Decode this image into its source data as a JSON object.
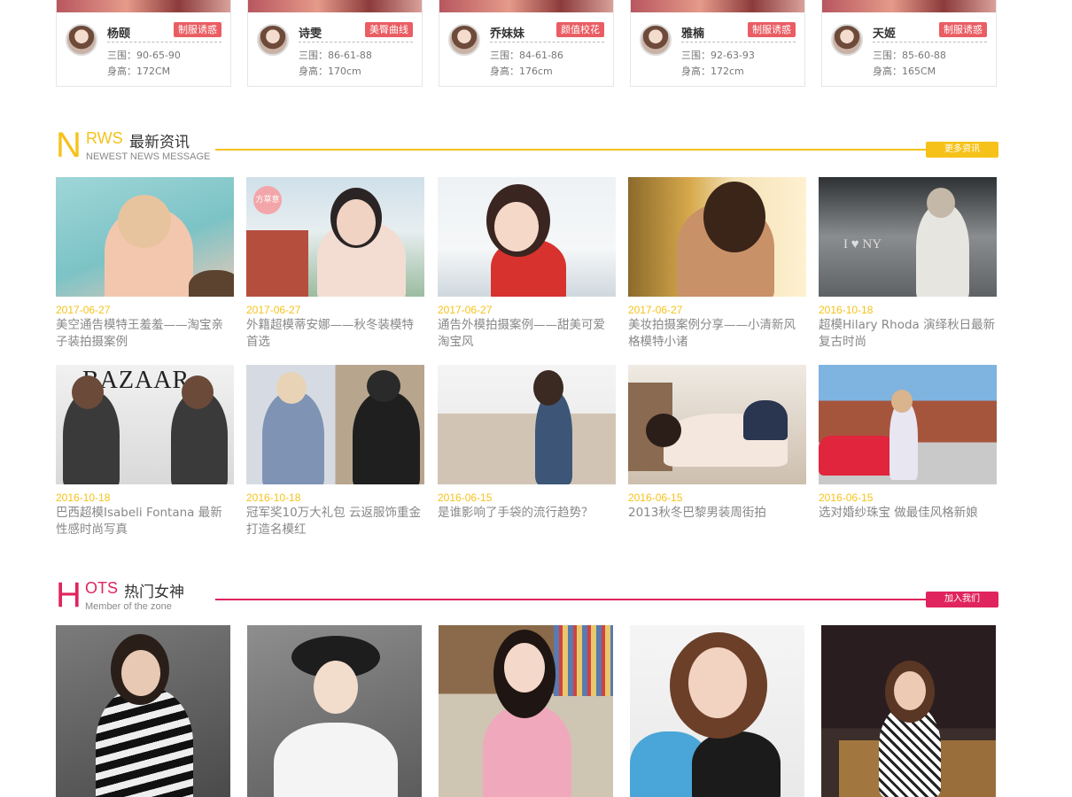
{
  "models": [
    {
      "name": "杨颐",
      "badge": "制服诱惑",
      "measure": "三围：90-65-90",
      "height": "身高：172CM"
    },
    {
      "name": "诗雯",
      "badge": "美臀曲线",
      "measure": "三围：86-61-88",
      "height": "身高：170cm"
    },
    {
      "name": "乔妹妹",
      "badge": "颜值校花",
      "measure": "三围：84-61-86",
      "height": "身高：176cm"
    },
    {
      "name": "雅楠",
      "badge": "制服诱惑",
      "measure": "三围：92-63-93",
      "height": "身高：172cm"
    },
    {
      "name": "天姬",
      "badge": "制服诱惑",
      "measure": "三围：85-60-88",
      "height": "身高：165CM"
    }
  ],
  "news_section": {
    "big_letter": "N",
    "small_letters": "RWS",
    "title": "最新资讯",
    "subtitle": "NEWEST NEWS MESSAGE",
    "more_label": "更多资讯",
    "accent": "#f6c21a"
  },
  "news": [
    {
      "date": "2017-06-27",
      "title": "美空通告模特王羞羞——淘宝亲子装拍摄案例"
    },
    {
      "date": "2017-06-27",
      "title": "外籍超模蒂安娜——秋冬装模特首选"
    },
    {
      "date": "2017-06-27",
      "title": "通告外模拍摄案例——甜美可爱淘宝风"
    },
    {
      "date": "2017-06-27",
      "title": "美妆拍摄案例分享——小清新风格模特小诸"
    },
    {
      "date": "2016-10-18",
      "title": "超模Hilary Rhoda 演绎秋日最新复古时尚"
    },
    {
      "date": "2016-10-18",
      "title": "巴西超模Isabeli Fontana 最新性感时尚写真"
    },
    {
      "date": "2016-10-18",
      "title": "冠军奖10万大礼包 云返服饰重金打造名模红"
    },
    {
      "date": "2016-06-15",
      "title": "是谁影响了手袋的流行趋势？"
    },
    {
      "date": "2016-06-15",
      "title": "2013秋冬巴黎男装周街拍"
    },
    {
      "date": "2016-06-15",
      "title": "选对婚纱珠宝 做最佳风格新娘"
    }
  ],
  "image_texts": {
    "bazaar": "BAZAAR",
    "stamp": "方草意"
  },
  "hots_section": {
    "big_letter": "H",
    "small_letters": "OTS",
    "title": "热门女神",
    "subtitle": "Member of the zone",
    "more_label": "加入我们",
    "accent": "#e0245e"
  }
}
